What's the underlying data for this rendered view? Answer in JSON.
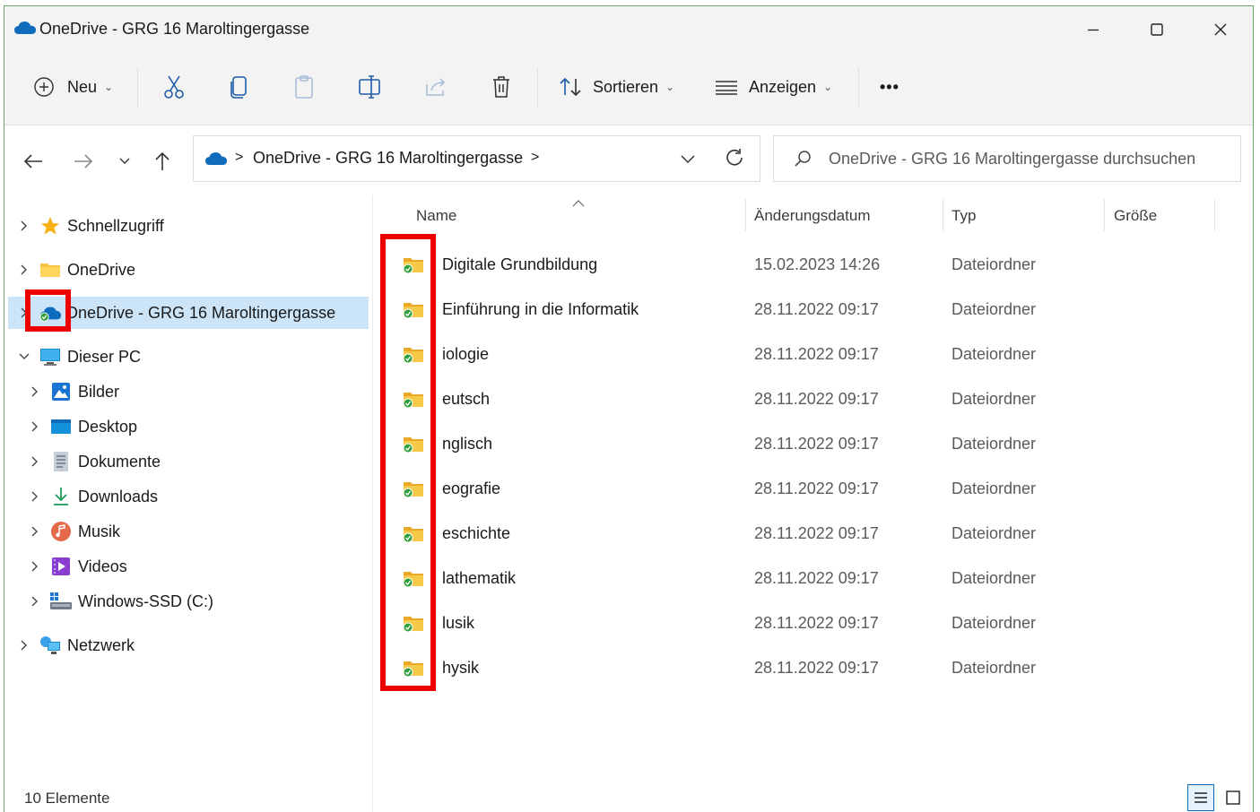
{
  "window": {
    "title": "OneDrive - GRG 16 Maroltingergasse",
    "controls": {
      "minimize_icon": "minimize-icon",
      "maximize_icon": "maximize-icon",
      "close_icon": "close-icon"
    }
  },
  "toolbar": {
    "new_label": "Neu",
    "sort_label": "Sortieren",
    "view_label": "Anzeigen",
    "more_label": "•••"
  },
  "address": {
    "path": "OneDrive - GRG 16 Maroltingergasse",
    "separator": ">",
    "search_placeholder": "OneDrive - GRG 16 Maroltingergasse durchsuchen"
  },
  "sidebar": {
    "items": [
      {
        "label": "Schnellzugriff",
        "icon": "star-icon"
      },
      {
        "label": "OneDrive",
        "icon": "folder-icon"
      },
      {
        "label": "OneDrive - GRG 16 Maroltingergasse",
        "icon": "cloud-icon"
      },
      {
        "label": "Dieser PC",
        "icon": "pc-icon"
      },
      {
        "label": "Bilder",
        "icon": "pictures-icon"
      },
      {
        "label": "Desktop",
        "icon": "desktop-icon"
      },
      {
        "label": "Dokumente",
        "icon": "documents-icon"
      },
      {
        "label": "Downloads",
        "icon": "download-icon"
      },
      {
        "label": "Musik",
        "icon": "music-icon"
      },
      {
        "label": "Videos",
        "icon": "videos-icon"
      },
      {
        "label": "Windows-SSD (C:)",
        "icon": "drive-icon"
      },
      {
        "label": "Netzwerk",
        "icon": "network-icon"
      }
    ]
  },
  "columns": {
    "name": "Name",
    "date": "Änderungsdatum",
    "type": "Typ",
    "size": "Größe"
  },
  "files": [
    {
      "name": "Digitale Grundbildung",
      "date": "15.02.2023 14:26",
      "type": "Dateiordner"
    },
    {
      "name": "Einführung in die Informatik",
      "date": "28.11.2022 09:17",
      "type": "Dateiordner"
    },
    {
      "name": "iologie",
      "date": "28.11.2022 09:17",
      "type": "Dateiordner"
    },
    {
      "name": "eutsch",
      "date": "28.11.2022 09:17",
      "type": "Dateiordner"
    },
    {
      "name": "nglisch",
      "date": "28.11.2022 09:17",
      "type": "Dateiordner"
    },
    {
      "name": "eografie",
      "date": "28.11.2022 09:17",
      "type": "Dateiordner"
    },
    {
      "name": "eschichte",
      "date": "28.11.2022 09:17",
      "type": "Dateiordner"
    },
    {
      "name": "lathematik",
      "date": "28.11.2022 09:17",
      "type": "Dateiordner"
    },
    {
      "name": "lusik",
      "date": "28.11.2022 09:17",
      "type": "Dateiordner"
    },
    {
      "name": "hysik",
      "date": "28.11.2022 09:17",
      "type": "Dateiordner"
    }
  ],
  "status": {
    "count": "10 Elemente"
  },
  "colors": {
    "highlight": "#ee0000",
    "selected": "#cce4f7",
    "sync_ok": "#2e9d3a",
    "folder": "#f5c342"
  }
}
